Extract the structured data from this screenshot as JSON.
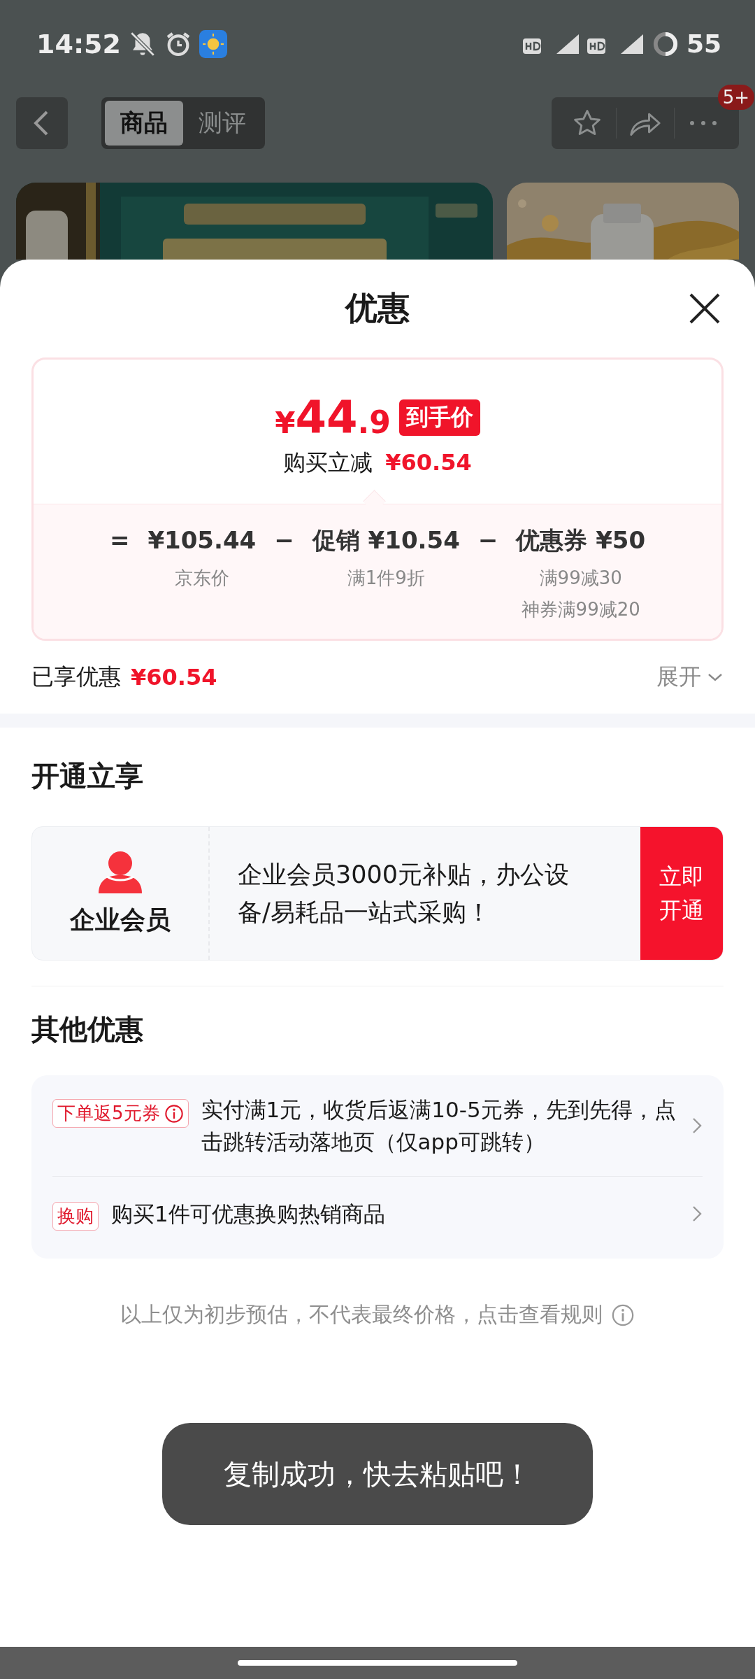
{
  "status_bar": {
    "time": "14:52",
    "battery": "55"
  },
  "header": {
    "tabs": [
      {
        "label": "商品",
        "selected": true
      },
      {
        "label": "测评",
        "selected": false
      }
    ],
    "badge": "5+"
  },
  "sheet": {
    "title": "优惠",
    "currency": "¥",
    "price_integer": "44",
    "price_decimal": ".9",
    "price_tag": "到手价",
    "instant_label": "购买立减",
    "instant_amount": "¥60.54",
    "breakdown": [
      {
        "kind": "operator",
        "text": "="
      },
      {
        "kind": "term",
        "amount": "¥105.44",
        "notes": [
          "京东价"
        ]
      },
      {
        "kind": "operator",
        "text": "−"
      },
      {
        "kind": "term",
        "label": "促销",
        "amount": "¥10.54",
        "notes": [
          "满1件9折"
        ]
      },
      {
        "kind": "operator",
        "text": "−"
      },
      {
        "kind": "term",
        "label": "优惠券",
        "amount": "¥50",
        "notes": [
          "满99减30",
          "神券满99减20"
        ]
      }
    ],
    "enjoyed_label": "已享优惠",
    "enjoyed_amount": "¥60.54",
    "expand_label": "展开"
  },
  "membership": {
    "heading": "开通立享",
    "name": "企业会员",
    "description": "企业会员3000元补贴，办公设备/易耗品一站式采购！",
    "button": "立即开通"
  },
  "other_offers": {
    "heading": "其他优惠",
    "items": [
      {
        "tag": "下单返5元券",
        "has_info": true,
        "text": "实付满1元，收货后返满10-5元券，先到先得，点击跳转活动落地页（仅app可跳转）"
      },
      {
        "tag": "换购",
        "has_info": false,
        "text": "购买1件可优惠换购热销商品"
      }
    ]
  },
  "disclaimer": "以上仅为初步预估，不代表最终价格，点击查看规则",
  "toast": "复制成功，快去粘贴吧！"
}
